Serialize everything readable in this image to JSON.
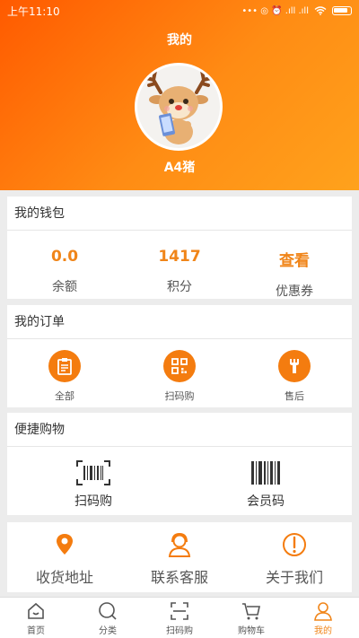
{
  "status_bar": {
    "time": "上午11:10",
    "icons_text": "••• ◎ ⏰ .ıll .ıll"
  },
  "page": {
    "title": "我的"
  },
  "profile": {
    "username": "A4猪",
    "avatar": "deer-mascot-avatar"
  },
  "wallet": {
    "title": "我的钱包",
    "items": [
      {
        "value": "0.0",
        "label": "余额"
      },
      {
        "value": "1417",
        "label": "积分"
      },
      {
        "value": "查看",
        "label": "优惠券"
      }
    ]
  },
  "orders": {
    "title": "我的订单",
    "items": [
      {
        "label": "全部",
        "icon": "clipboard-icon"
      },
      {
        "label": "扫码购",
        "icon": "qr-code-icon"
      },
      {
        "label": "售后",
        "icon": "wrench-icon"
      }
    ]
  },
  "quick_shop": {
    "title": "便捷购物",
    "items": [
      {
        "label": "扫码购",
        "icon": "scan-barcode-icon"
      },
      {
        "label": "会员码",
        "icon": "barcode-icon"
      }
    ]
  },
  "services": {
    "items": [
      {
        "label": "收货地址",
        "icon": "location-pin-icon"
      },
      {
        "label": "联系客服",
        "icon": "customer-service-icon"
      },
      {
        "label": "关于我们",
        "icon": "info-icon"
      }
    ]
  },
  "tabbar": {
    "items": [
      {
        "label": "首页",
        "icon": "home-icon"
      },
      {
        "label": "分类",
        "icon": "category-icon"
      },
      {
        "label": "扫码购",
        "icon": "scan-icon"
      },
      {
        "label": "购物车",
        "icon": "cart-icon"
      },
      {
        "label": "我的",
        "icon": "user-icon",
        "active": true
      }
    ]
  },
  "colors": {
    "accent": "#f08519",
    "header_start": "#ff5a00",
    "header_end": "#ffa21c"
  }
}
